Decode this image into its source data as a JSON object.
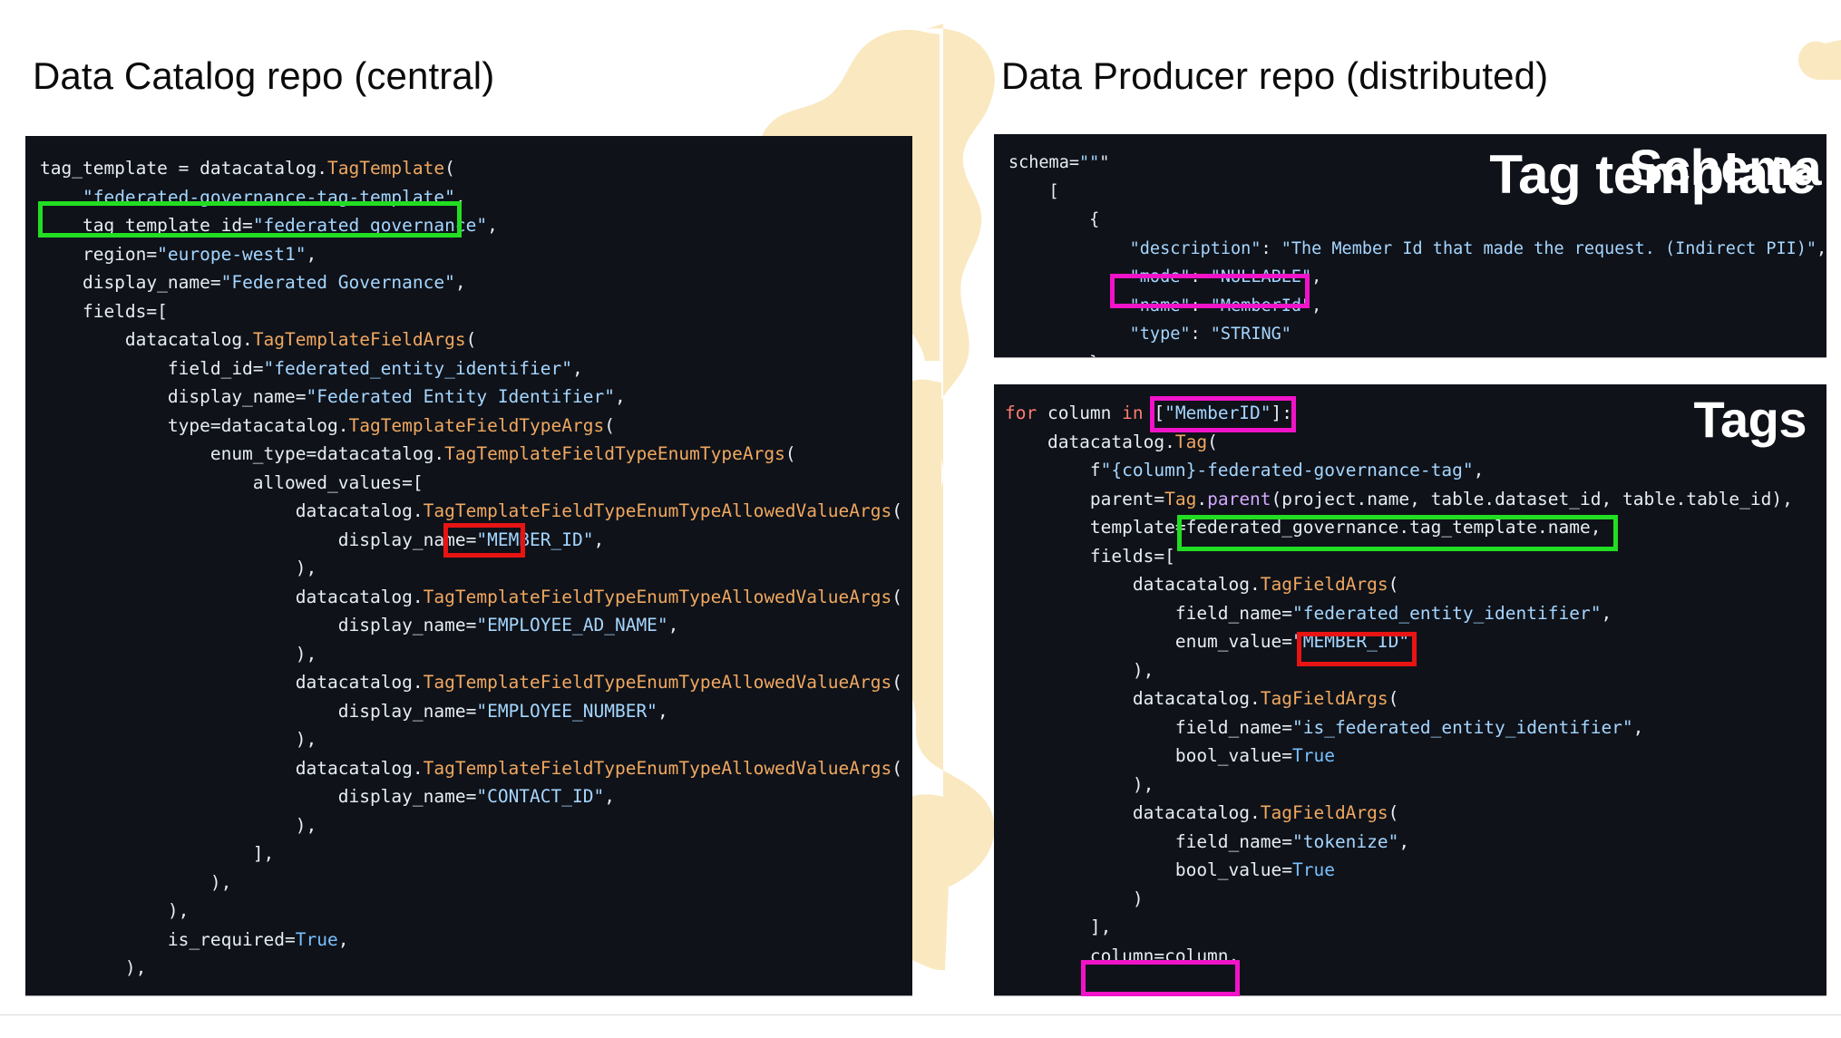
{
  "slide": {
    "heading_left": "Data Catalog repo (central)",
    "heading_right": "Data Producer repo (distributed)"
  },
  "colors": {
    "blob": "#fae8c0",
    "code_background": "#0f1219",
    "highlight_green": "#22dd22",
    "highlight_red": "#e81414",
    "highlight_magenta": "#f013c8",
    "heading_text": "#0b0b0b",
    "card_title_text": "#ffffff"
  },
  "cards": {
    "tag_template": {
      "title": "Tag template",
      "code": "tag_template = datacatalog.TagTemplate(\n    \"federated-governance-tag-template\",\n    tag_template_id=\"federated_governance\",\n    region=\"europe-west1\",\n    display_name=\"Federated Governance\",\n    fields=[\n        datacatalog.TagTemplateFieldArgs(\n            field_id=\"federated_entity_identifier\",\n            display_name=\"Federated Entity Identifier\",\n            type=datacatalog.TagTemplateFieldTypeArgs(\n                enum_type=datacatalog.TagTemplateFieldTypeEnumTypeArgs(\n                    allowed_values=[\n                        datacatalog.TagTemplateFieldTypeEnumTypeAllowedValueArgs(\n                            display_name=\"MEMBER_ID\",\n                        ),\n                        datacatalog.TagTemplateFieldTypeEnumTypeAllowedValueArgs(\n                            display_name=\"EMPLOYEE_AD_NAME\",\n                        ),\n                        datacatalog.TagTemplateFieldTypeEnumTypeAllowedValueArgs(\n                            display_name=\"EMPLOYEE_NUMBER\",\n                        ),\n                        datacatalog.TagTemplateFieldTypeEnumTypeAllowedValueArgs(\n                            display_name=\"CONTACT_ID\",\n                        ),\n                    ],\n                ),\n            ),\n            is_required=True,\n        ),",
      "highlights": [
        {
          "name": "tag-template-id",
          "color": "green",
          "text": "tag_template_id=\"federated_governance\","
        },
        {
          "name": "member-id-enum",
          "color": "red",
          "text": "\"MEMBER_ID\""
        }
      ]
    },
    "schema": {
      "title": "Schema",
      "code": "schema=\"\"\"\n    [\n        {\n            \"description\": \"The Member Id that made the request. (Indirect PII)\",\n            \"mode\": \"NULLABLE\",\n            \"name\": \"MemberId\",\n            \"type\": \"STRING\"\n        },",
      "highlights": [
        {
          "name": "schema-name-field",
          "color": "magenta",
          "text": "\"name\": \"MemberId\","
        }
      ]
    },
    "tags": {
      "title": "Tags",
      "code": "for column in [\"MemberID\"]:\n    datacatalog.Tag(\n        f\"{column}-federated-governance-tag\",\n        parent=Tag.parent(project.name, table.dataset_id, table.table_id),\n        template=federated_governance.tag_template.name,\n        fields=[\n            datacatalog.TagFieldArgs(\n                field_name=\"federated_entity_identifier\",\n                enum_value=\"MEMBER_ID\"\n            ),\n            datacatalog.TagFieldArgs(\n                field_name=\"is_federated_entity_identifier\",\n                bool_value=True\n            ),\n            datacatalog.TagFieldArgs(\n                field_name=\"tokenize\",\n                bool_value=True\n            )\n        ],\n        column=column,",
      "highlights": [
        {
          "name": "member-id-column-list",
          "color": "magenta",
          "text": "[\"MemberID\"]:"
        },
        {
          "name": "template-reference",
          "color": "green",
          "text": "federated_governance.tag_template.name,"
        },
        {
          "name": "enum-value-member-id",
          "color": "red",
          "text": "\"MEMBER_ID\""
        },
        {
          "name": "column-assignment",
          "color": "magenta",
          "text": "column=column,"
        }
      ]
    }
  }
}
